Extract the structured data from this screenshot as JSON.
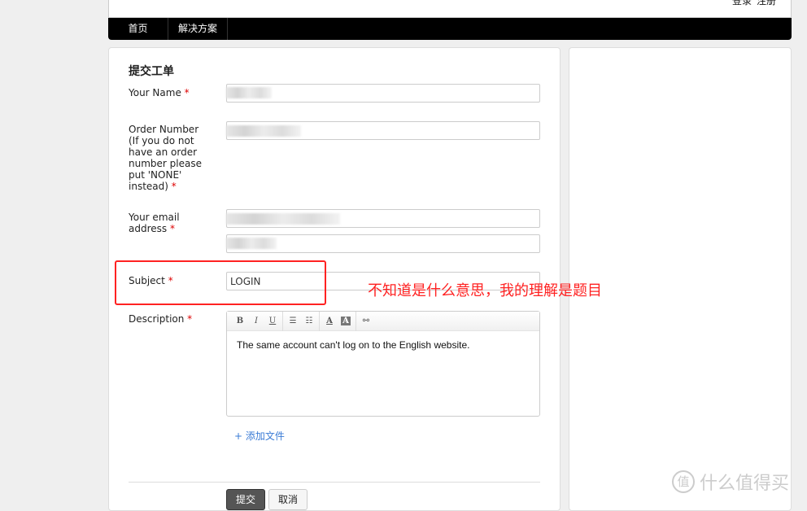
{
  "header": {
    "login": "登录",
    "register": "注册"
  },
  "nav": {
    "items": [
      {
        "label": "首页"
      },
      {
        "label": "解决方案"
      }
    ]
  },
  "form": {
    "title": "提交工单",
    "required_mark": "*",
    "name_label": "Your Name",
    "order_label": "Order Number (If you do not have an order number please put 'NONE' instead)",
    "email_label": "Your email address",
    "subject_label": "Subject",
    "subject_value": "LOGIN",
    "description_label": "Description",
    "description_text": "The same account can't log on to the English website.",
    "toolbar": {
      "bold": "B",
      "italic": "I",
      "underline": "U",
      "text_color": "A",
      "bg_color": "A"
    },
    "add_file": "+ 添加文件",
    "submit": "提交",
    "cancel": "取消"
  },
  "annotation": {
    "text": "不知道是什么意思，我的理解是题目",
    "color": "#ff2222"
  },
  "watermark": {
    "badge": "值",
    "text": "什么值得买"
  }
}
